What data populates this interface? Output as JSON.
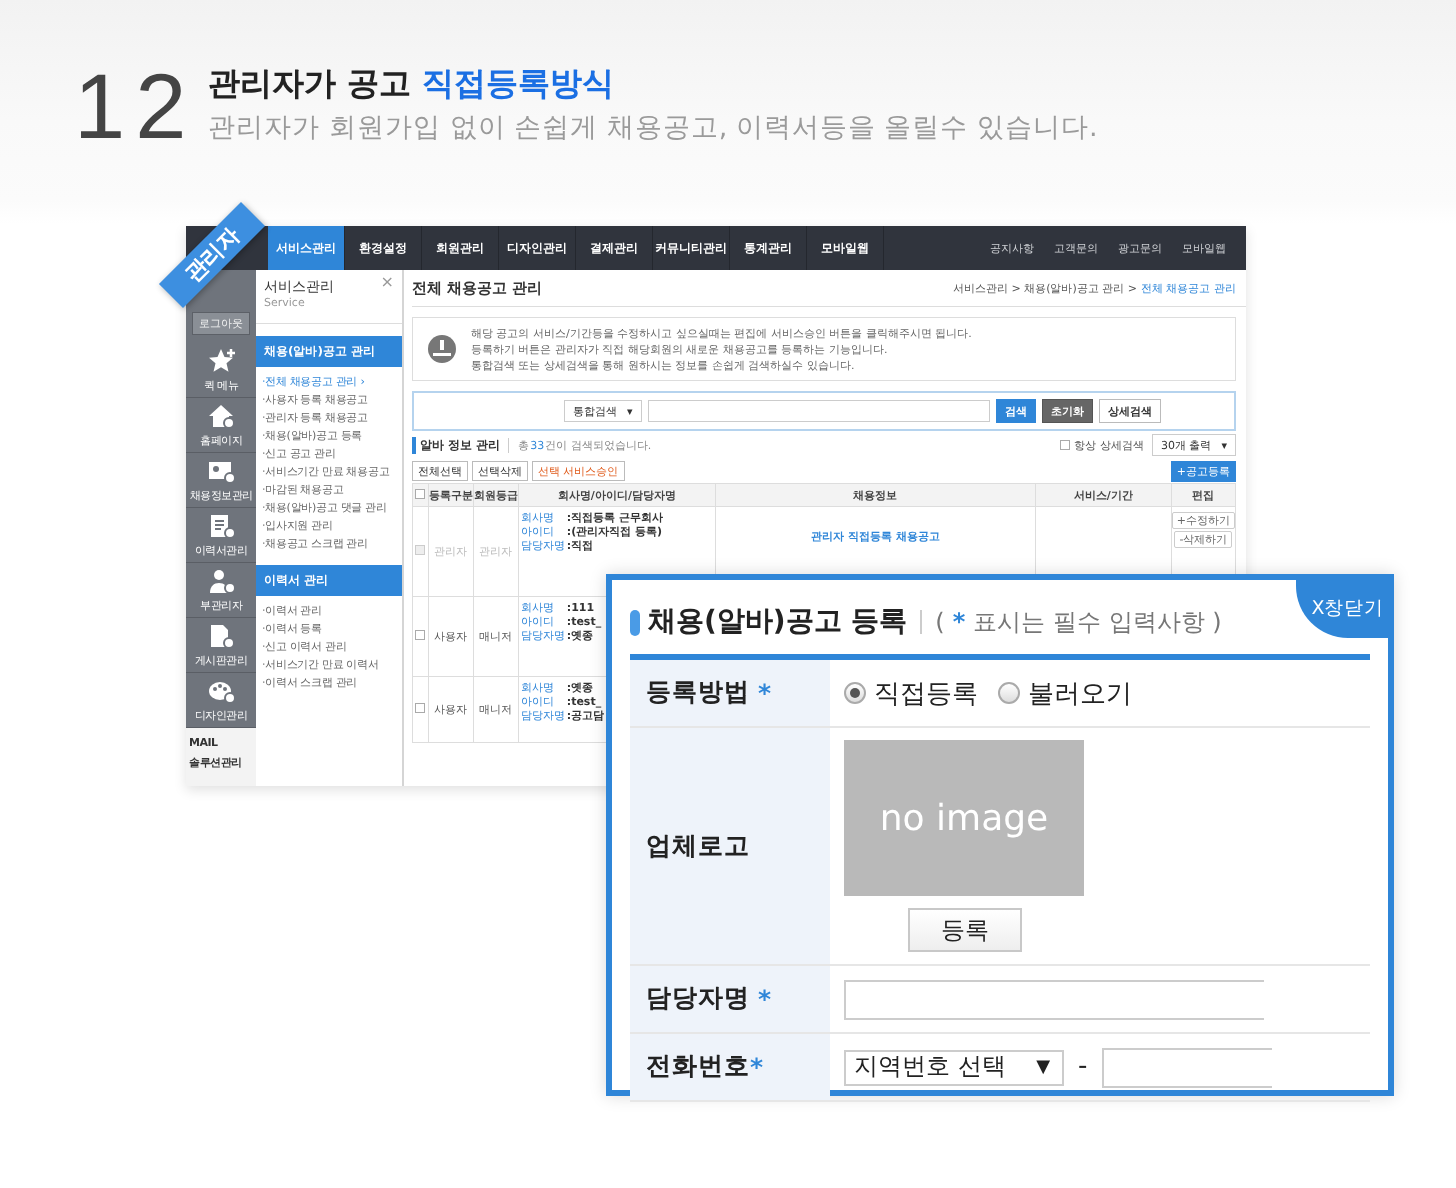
{
  "heading": {
    "number": "12",
    "title": "관리자가 공고",
    "title_highlight": "직접등록방식",
    "subtitle": "관리자가 회원가입 없이 손쉽게 채용공고, 이력서등을 올릴수 있습니다."
  },
  "admin": {
    "ribbon": "관리자",
    "nav": {
      "items": [
        {
          "label": "서비스관리",
          "selected": true
        },
        {
          "label": "환경설정",
          "selected": false
        },
        {
          "label": "회원관리",
          "selected": false
        },
        {
          "label": "디자인관리",
          "selected": false
        },
        {
          "label": "결제관리",
          "selected": false
        },
        {
          "label": "커뮤니티관리",
          "selected": false
        },
        {
          "label": "통계관리",
          "selected": false
        },
        {
          "label": "모바일웹",
          "selected": false
        }
      ],
      "links": [
        "공지사항",
        "고객문의",
        "광고문의",
        "모바일웹"
      ]
    },
    "rail": {
      "logout": "로그아웃",
      "items": [
        "퀵 메뉴",
        "홈페이지",
        "채용정보관리",
        "이력서관리",
        "부관리자",
        "게시판관리",
        "디자인관리"
      ],
      "footer": [
        "MAIL",
        "솔루션관리"
      ]
    },
    "sidebar": {
      "title": "서비스관리",
      "subtitle": "Service",
      "close": "×",
      "sections": [
        {
          "title": "채용(알바)공고 관리",
          "items": [
            {
              "label": "·전체 채용공고 관리 ›",
              "selected": true
            },
            {
              "label": "·사용자 등록 채용공고",
              "selected": false
            },
            {
              "label": "·관리자 등록 채용공고",
              "selected": false
            },
            {
              "label": "·채용(알바)공고 등록",
              "selected": false
            },
            {
              "label": "·신고 공고 관리",
              "selected": false
            },
            {
              "label": "·서비스기간 만료 채용공고",
              "selected": false
            },
            {
              "label": "·마감된 채용공고",
              "selected": false
            },
            {
              "label": "·채용(알바)공고 댓글 관리",
              "selected": false
            },
            {
              "label": "·입사지원 관리",
              "selected": false
            },
            {
              "label": "·채용공고 스크랩 관리",
              "selected": false
            }
          ]
        },
        {
          "title": "이력서 관리",
          "items": [
            {
              "label": "·이력서 관리",
              "selected": false
            },
            {
              "label": "·이력서 등록",
              "selected": false
            },
            {
              "label": "·신고 이력서 관리",
              "selected": false
            },
            {
              "label": "·서비스기간 만료 이력서",
              "selected": false
            },
            {
              "label": "·이력서 스크랩 관리",
              "selected": false
            }
          ]
        }
      ]
    },
    "main": {
      "title": "전체 채용공고 관리",
      "breadcrumb_path": "서비스관리 > 채용(알바)공고 관리 >",
      "breadcrumb_current": "전체 채용공고 관리",
      "notice": [
        "해당 공고의 서비스/기간등을 수정하시고 싶으실때는 편집에 서비스승인 버튼을 클릭해주시면 됩니다.",
        "등록하기 버튼은 관리자가 직접 해당회원의 새로운 채용공고를 등록하는 기능입니다.",
        "통합검색 또는 상세검색을 통해 원하시는 정보를 손쉽게 검색하실수 있습니다."
      ],
      "search": {
        "scope": "통합검색",
        "arrow": "▾",
        "buttons": [
          "검색",
          "초기화",
          "상세검색"
        ]
      },
      "list": {
        "title": "알바 정보 관리",
        "count_prefix": "총",
        "count": "33",
        "count_suffix": "건이 검색되었습니다.",
        "always_detail": {
          "label": "항상 상세검색",
          "checked": false
        },
        "per_page": "30개 출력",
        "per_page_arrow": "▾"
      },
      "toolbar": [
        "전체선택",
        "선택삭제",
        "선택 서비스승인"
      ],
      "add_button": "+공고등록",
      "table": {
        "all_checked": false,
        "columns": [
          "등록구분",
          "회원등급",
          "회사명/아이디/담당자명",
          "채용정보",
          "서비스/기간",
          "편집"
        ],
        "rows": [
          {
            "checked": false,
            "disabled": true,
            "type": "관리자",
            "grade": "관리자",
            "info": [
              {
                "label": "회사명",
                "value": ":직접등록 근무회사"
              },
              {
                "label": "아이디",
                "value": ":(관리자직접 등록)"
              },
              {
                "label": "담당자명",
                "value": ":직접"
              }
            ],
            "job": "관리자 직접등록 채용공고",
            "edit": [
              "+수정하기",
              "-삭제하기"
            ]
          },
          {
            "checked": false,
            "disabled": false,
            "type": "사용자",
            "grade": "매니저",
            "info": [
              {
                "label": "회사명",
                "value": ":111"
              },
              {
                "label": "아이디",
                "value": ":test_"
              },
              {
                "label": "담당자명",
                "value": ":옛종"
              }
            ]
          },
          {
            "checked": false,
            "disabled": false,
            "type": "사용자",
            "grade": "매니저",
            "info": [
              {
                "label": "회사명",
                "value": ":옛종"
              },
              {
                "label": "아이디",
                "value": ":test_"
              },
              {
                "label": "담당자명",
                "value": ":공고담"
              }
            ]
          }
        ]
      }
    }
  },
  "popup": {
    "title": "채용(알바)공고 등록",
    "note_open": "(",
    "required_mark": "*",
    "note_text": "표시는 필수 입력사항 )",
    "close": "X창닫기",
    "fields": [
      {
        "kind": "radio",
        "label": "등록방법",
        "required": true,
        "options": [
          {
            "label": "직접등록",
            "selected": true
          },
          {
            "label": "불러오기",
            "selected": false
          }
        ]
      },
      {
        "kind": "logo",
        "label": "업체로고",
        "required": false,
        "image_text": "no image",
        "button": "등록"
      },
      {
        "kind": "text",
        "label": "담당자명",
        "required": true
      },
      {
        "kind": "phone",
        "label": "전화번호",
        "required": true,
        "area": "지역번호 선택",
        "arrow": "▼",
        "separator": "-"
      }
    ]
  }
}
